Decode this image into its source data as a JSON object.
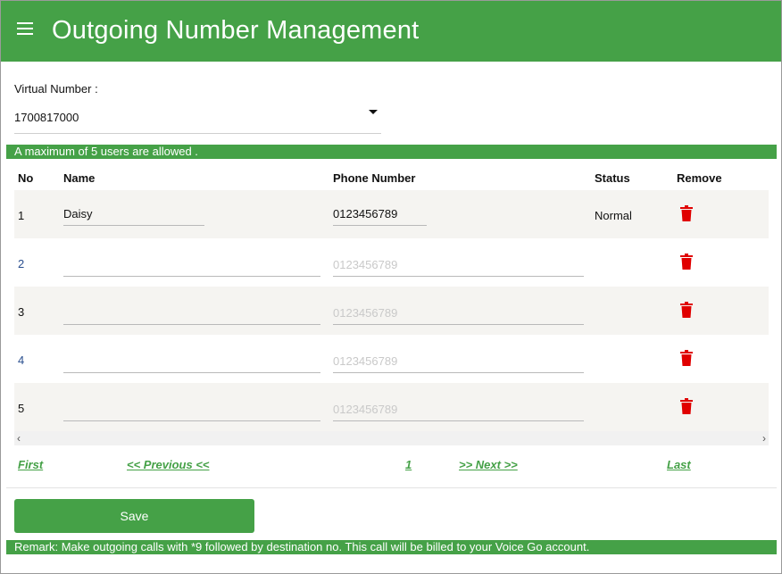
{
  "header": {
    "title": "Outgoing Number Management",
    "menu_icon": "hamburger-menu-icon"
  },
  "virtual_number": {
    "label": "Virtual Number :",
    "selected": "1700817000"
  },
  "notice": "A maximum of 5 users are allowed .",
  "table": {
    "columns": [
      "No",
      "Name",
      "Phone Number",
      "Status",
      "Remove"
    ],
    "rows": [
      {
        "no": "1",
        "name": "Daisy",
        "phone": "0123456789",
        "phone_placeholder": "",
        "status": "Normal"
      },
      {
        "no": "2",
        "name": "",
        "phone": "",
        "phone_placeholder": "0123456789",
        "status": ""
      },
      {
        "no": "3",
        "name": "",
        "phone": "",
        "phone_placeholder": "0123456789",
        "status": ""
      },
      {
        "no": "4",
        "name": "",
        "phone": "",
        "phone_placeholder": "0123456789",
        "status": ""
      },
      {
        "no": "5",
        "name": "",
        "phone": "",
        "phone_placeholder": "0123456789",
        "status": ""
      }
    ],
    "remove_icon": "trash-icon"
  },
  "scrollbar": {
    "left": "‹",
    "right": "›"
  },
  "pagination": {
    "first": "First",
    "previous": "<< Previous <<",
    "page": "1",
    "next": ">> Next >>",
    "last": "Last"
  },
  "save_label": "Save",
  "remark": "Remark: Make outgoing calls with *9 followed by destination no. This call will be billed to your Voice Go account.",
  "colors": {
    "primary": "#45a147",
    "remove": "#e00000",
    "row_shade": "#f5f4f1"
  }
}
